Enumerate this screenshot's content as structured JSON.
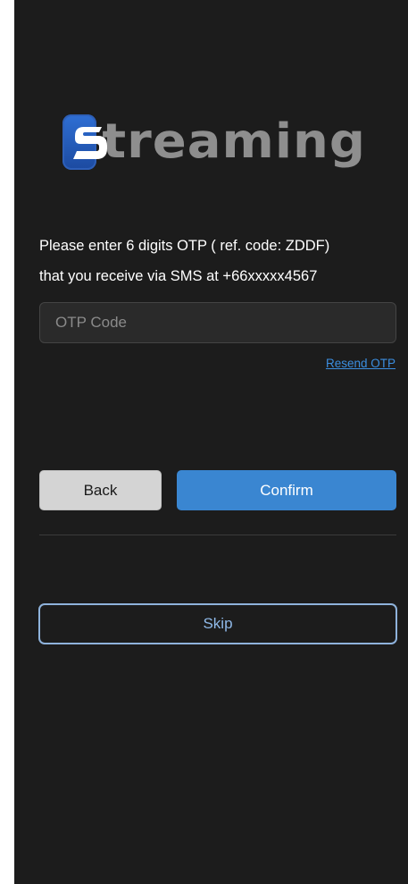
{
  "brand": {
    "logo_text": "treaming",
    "logo_letter": "S"
  },
  "otp": {
    "instruction_line1": "Please enter 6 digits OTP ( ref. code: ZDDF)",
    "instruction_line2": "that you receive via SMS at +66xxxxx4567",
    "input_placeholder": "OTP Code",
    "input_value": "",
    "resend_label": "Resend OTP"
  },
  "actions": {
    "back_label": "Back",
    "confirm_label": "Confirm",
    "skip_label": "Skip"
  },
  "colors": {
    "background": "#1c1c1c",
    "accent": "#3a86d1",
    "link": "#3b8ee0",
    "logo_badge": "#2f6fd4",
    "logo_text": "#8e8e8e"
  }
}
